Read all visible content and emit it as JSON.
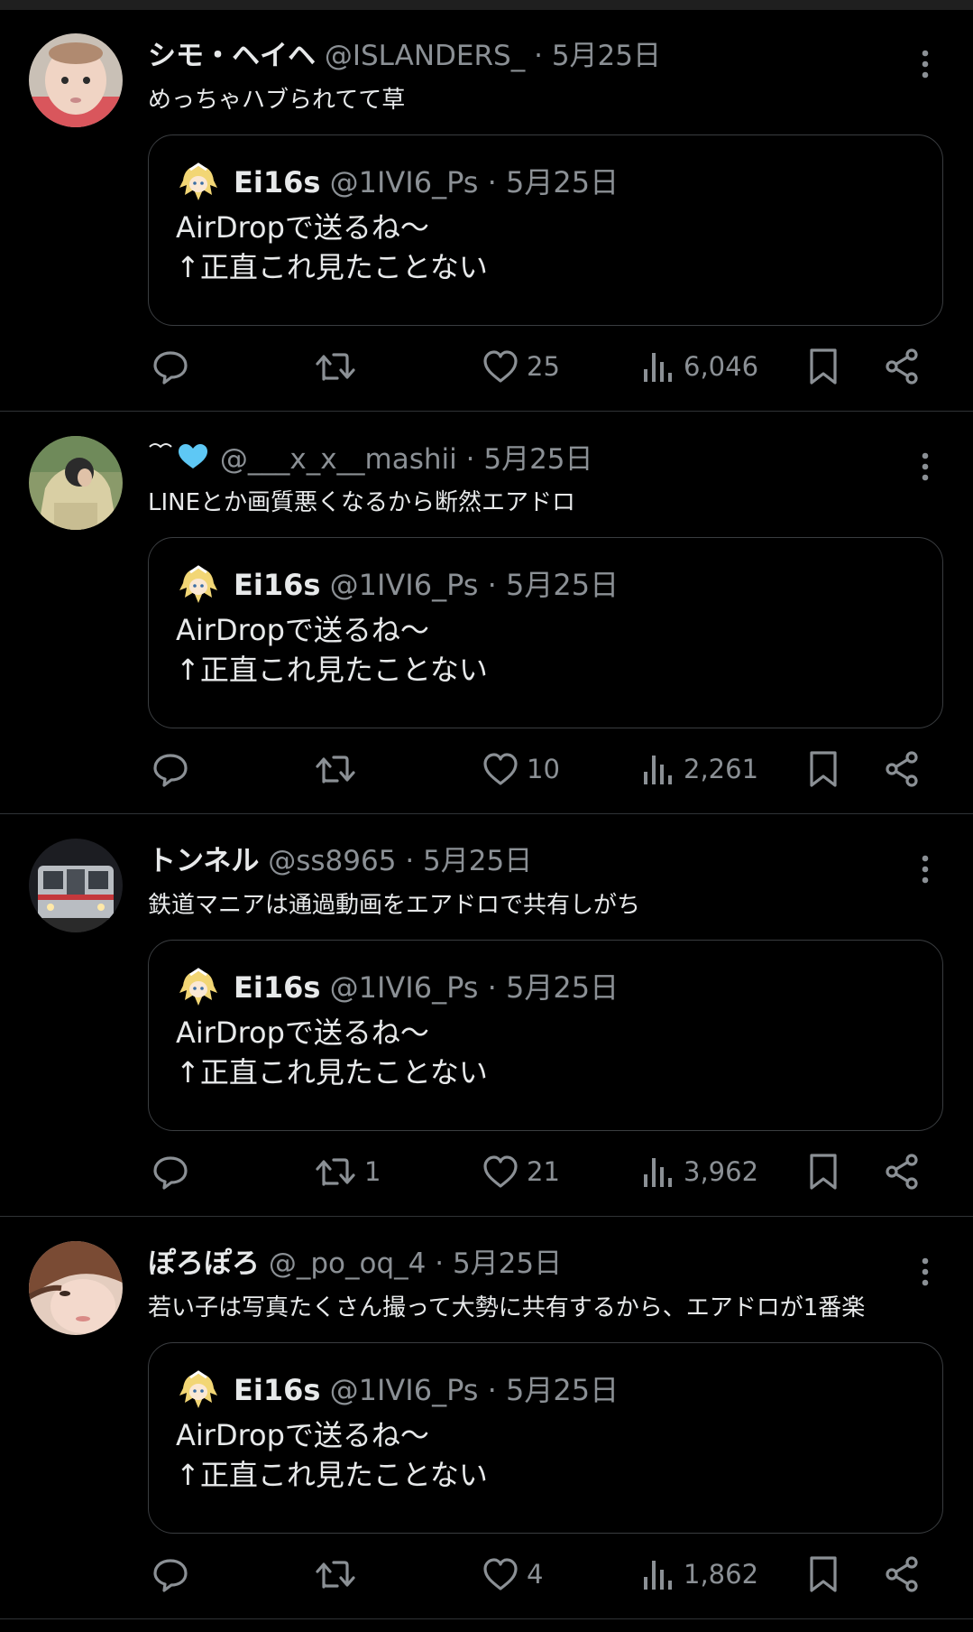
{
  "tweets": [
    {
      "name": "シモ・ヘイヘ",
      "handle": "@ISLANDERS_",
      "dot": "·",
      "date": "5月25日",
      "text": "めっちゃハブられてて草",
      "quote": {
        "name": "Ei16s",
        "handle": "@1IVI6_Ps",
        "dot": "·",
        "date": "5月25日",
        "line1": "AirDropで送るね〜",
        "line2": "↑正直これ見たことない"
      },
      "counts": {
        "reply": "",
        "retweet": "",
        "like": "25",
        "views": "6,046"
      },
      "avatar": "baby-photo"
    },
    {
      "name": "",
      "name_icons": "black-heart-and-light-blue-heart-emoji",
      "handle": "@___x_x__mashii",
      "dot": "·",
      "date": "5月25日",
      "text": "LINEとか画質悪くなるから断然エアドロ",
      "quote": {
        "name": "Ei16s",
        "handle": "@1IVI6_Ps",
        "dot": "·",
        "date": "5月25日",
        "line1": "AirDropで送るね〜",
        "line2": "↑正直これ見たことない"
      },
      "counts": {
        "reply": "",
        "retweet": "",
        "like": "10",
        "views": "2,261"
      },
      "avatar": "person-in-hoodie"
    },
    {
      "name": "トンネル",
      "handle": "@ss8965",
      "dot": "·",
      "date": "5月25日",
      "text": "鉄道マニアは通過動画をエアドロで共有しがち",
      "quote": {
        "name": "Ei16s",
        "handle": "@1IVI6_Ps",
        "dot": "·",
        "date": "5月25日",
        "line1": "AirDropで送るね〜",
        "line2": "↑正直これ見たことない"
      },
      "counts": {
        "reply": "",
        "retweet": "1",
        "like": "21",
        "views": "3,962"
      },
      "avatar": "train-photo"
    },
    {
      "name": "ぽろぽろ",
      "handle": "@_po_oq_4",
      "dot": "·",
      "date": "5月25日",
      "text": "若い子は写真たくさん撮って大勢に共有するから、エアドロが1番楽",
      "quote": {
        "name": "Ei16s",
        "handle": "@1IVI6_Ps",
        "dot": "·",
        "date": "5月25日",
        "line1": "AirDropで送るね〜",
        "line2": "↑正直これ見たことない"
      },
      "counts": {
        "reply": "",
        "retweet": "",
        "like": "4",
        "views": "1,862"
      },
      "avatar": "girl-photo"
    }
  ],
  "colors": {
    "background": "#000000",
    "text": "#e7e9ea",
    "muted": "#8b9095",
    "border": "#2f3336",
    "heart_light_blue": "#5ec8f5"
  },
  "icons": {
    "reply": "speech-bubble-icon",
    "retweet": "retweet-icon",
    "like": "heart-icon",
    "views": "bar-chart-icon",
    "bookmark": "bookmark-icon",
    "share": "share-icon",
    "more": "vertical-dots-icon"
  }
}
